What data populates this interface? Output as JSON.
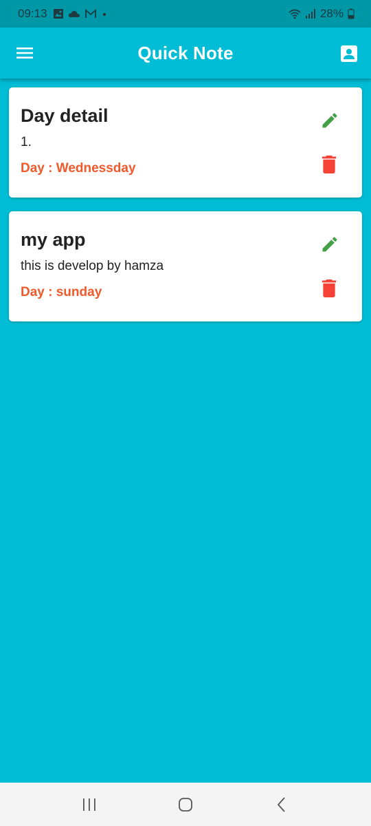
{
  "status_bar": {
    "time": "09:13",
    "notification_icons": [
      "image-icon",
      "cloud-icon",
      "gmail-icon",
      "dot-icon"
    ],
    "battery": "28%",
    "right_icons": [
      "wifi-icon",
      "signal-icon",
      "battery-icon"
    ]
  },
  "app_bar": {
    "title": "Quick Note",
    "left_icon": "menu-icon",
    "right_icon": "profile-icon",
    "background": "#00bcd4"
  },
  "notes": [
    {
      "title": "Day detail",
      "body": "1.",
      "day": "Day : Wednessday"
    },
    {
      "title": "my app",
      "body": "this is develop by hamza",
      "day": "Day : sunday"
    }
  ],
  "colors": {
    "accent": "#00bcd4",
    "status_bar": "#0097a7",
    "day_text": "#f0592a",
    "edit_icon": "#43a047",
    "delete_icon": "#f44336"
  },
  "nav_bar": {
    "buttons": [
      "recent-apps-icon",
      "home-icon",
      "back-icon"
    ]
  }
}
